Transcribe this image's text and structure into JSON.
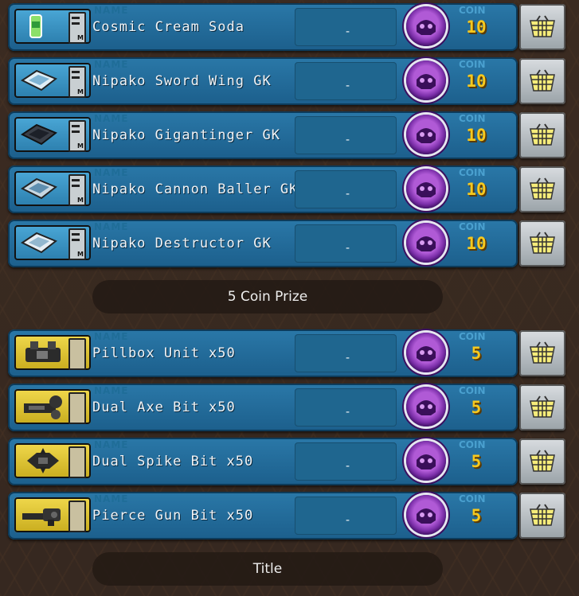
{
  "labels": {
    "name": "NAME",
    "coin": "COIN",
    "dash": "-"
  },
  "prize10": [
    {
      "name": "Cosmic Cream Soda",
      "coin": "10",
      "icon": "soda-can-icon"
    },
    {
      "name": "Nipako Sword Wing GK",
      "coin": "10",
      "icon": "model-box-icon"
    },
    {
      "name": "Nipako Gigantinger GK",
      "coin": "10",
      "icon": "model-box-icon"
    },
    {
      "name": "Nipako Cannon Baller GK",
      "coin": "10",
      "icon": "model-box-icon"
    },
    {
      "name": "Nipako Destructor GK",
      "coin": "10",
      "icon": "model-box-icon"
    }
  ],
  "section_banner": "5 Coin Prize",
  "prize5": [
    {
      "name": "Pillbox Unit x50",
      "coin": "5",
      "icon": "pillbox-part-icon"
    },
    {
      "name": "Dual Axe Bit x50",
      "coin": "5",
      "icon": "axe-bit-part-icon"
    },
    {
      "name": "Dual Spike Bit x50",
      "coin": "5",
      "icon": "spike-bit-part-icon"
    },
    {
      "name": "Pierce Gun Bit x50",
      "coin": "5",
      "icon": "gun-bit-part-icon"
    }
  ],
  "footer_banner": "Title",
  "colors": {
    "row_blue": "#2a78a8",
    "coin_gold": "#f6c81e",
    "coin_purple": "#7a2ea8"
  }
}
